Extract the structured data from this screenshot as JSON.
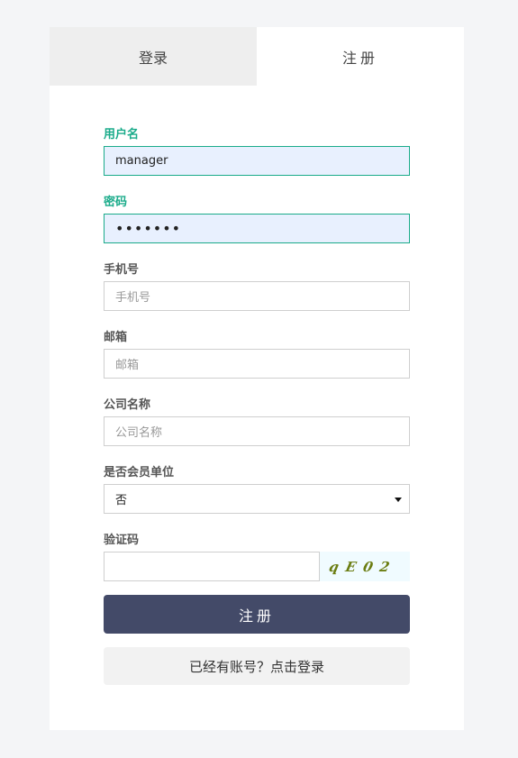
{
  "tabs": {
    "login": "登录",
    "register": "注册"
  },
  "form": {
    "username": {
      "label": "用户名",
      "value": "manager"
    },
    "password": {
      "label": "密码",
      "value": "•••••••"
    },
    "phone": {
      "label": "手机号",
      "placeholder": "手机号"
    },
    "email": {
      "label": "邮箱",
      "placeholder": "邮箱"
    },
    "company": {
      "label": "公司名称",
      "placeholder": "公司名称"
    },
    "member": {
      "label": "是否会员单位",
      "value": "否"
    },
    "captcha": {
      "label": "验证码",
      "image_text": "qE02"
    }
  },
  "buttons": {
    "register": "注册",
    "to_login": "已经有账号？点击登录"
  },
  "colors": {
    "accent": "#1aab8a",
    "primary_button": "#434a68",
    "captcha_text": "#6b7d12"
  }
}
